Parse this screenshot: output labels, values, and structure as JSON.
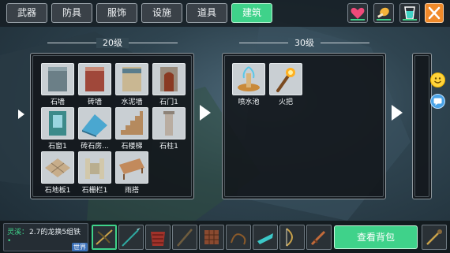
{
  "top_tabs": {
    "weapon": "武器",
    "armor": "防具",
    "clothes": "服饰",
    "facility": "设施",
    "items": "道具",
    "build": "建筑"
  },
  "top_buttons": {
    "heart": "heart-icon",
    "food": "food-icon",
    "drink": "drink-icon",
    "close": "close-icon"
  },
  "levels": {
    "level20": "20级",
    "level30": "30级"
  },
  "level20_items": [
    "石墙",
    "砖墙",
    "水泥墙",
    "石门1",
    "石窗1",
    "砖石房...",
    "石楼梯",
    "石柱1",
    "石地板1",
    "石栅栏1",
    "雨搭"
  ],
  "level30_items": [
    "喷水池",
    "火把"
  ],
  "chat": {
    "name": "灵溪：",
    "message": "2.7的龙换5组铁",
    "dot": "•",
    "world": "世界"
  },
  "bottom": {
    "open_bag": "查看背包"
  },
  "colors": {
    "accent": "#3fd28a",
    "close": "#f08a2a",
    "panel_bg": "#121619"
  }
}
